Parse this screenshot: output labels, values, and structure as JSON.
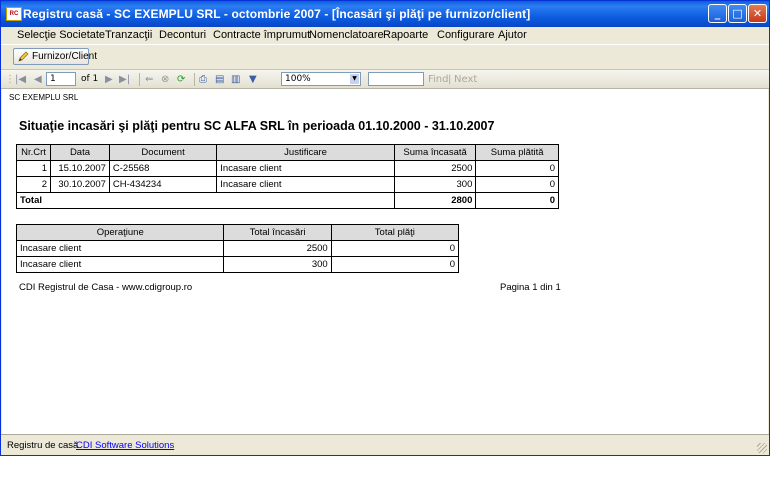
{
  "window": {
    "title": "Registru casă - SC EXEMPLU SRL - octombrie 2007 - [Încasări şi plăţi pe furnizor/client]",
    "app_icon_text": "RC",
    "controls": {
      "minimize": "_",
      "maximize": "□",
      "close": "✕"
    }
  },
  "menu": [
    "Selecţie Societate",
    "Tranzacţii",
    "Deconturi",
    "Contracte împrumut",
    "Nomenclatoare",
    "Rapoarte",
    "Configurare",
    "Ajutor"
  ],
  "toolbar": {
    "furnizor_button": "Furnizor/Client",
    "pencil_icon": "pencil-icon"
  },
  "report_toolbar": {
    "page_value": "1",
    "page_of": "of 1",
    "zoom": "100%",
    "find_label": "Find",
    "next_label": "Next",
    "separator": "|"
  },
  "report": {
    "company": "SC EXEMPLU SRL",
    "title": "Situaţie incasări şi plăţi pentru SC ALFA SRL în perioada  01.10.2000 - 31.10.2007",
    "table1": {
      "headers": [
        "Nr.Crt",
        "Data",
        "Document",
        "Justificare",
        "Suma încasată",
        "Suma plătită"
      ],
      "rows": [
        [
          "1",
          "15.10.2007",
          "C-25568",
          "Incasare client",
          "2500",
          "0"
        ],
        [
          "2",
          "30.10.2007",
          "CH-434234",
          "Incasare client",
          "300",
          "0"
        ]
      ],
      "total": {
        "label": "Total",
        "incasat": "2800",
        "platit": "0"
      }
    },
    "table2": {
      "headers": [
        "Operaţiune",
        "Total încasări",
        "Total plăţi"
      ],
      "rows": [
        [
          "Incasare client",
          "2500",
          "0"
        ],
        [
          "Incasare client",
          "300",
          "0"
        ]
      ]
    },
    "footer_left": "CDI Registrul de Casa -  www.cdigroup.ro",
    "footer_right": "Pagina 1 din 1"
  },
  "statusbar": {
    "left": "Registru de casă",
    "link": "CDI Software Solutions"
  }
}
